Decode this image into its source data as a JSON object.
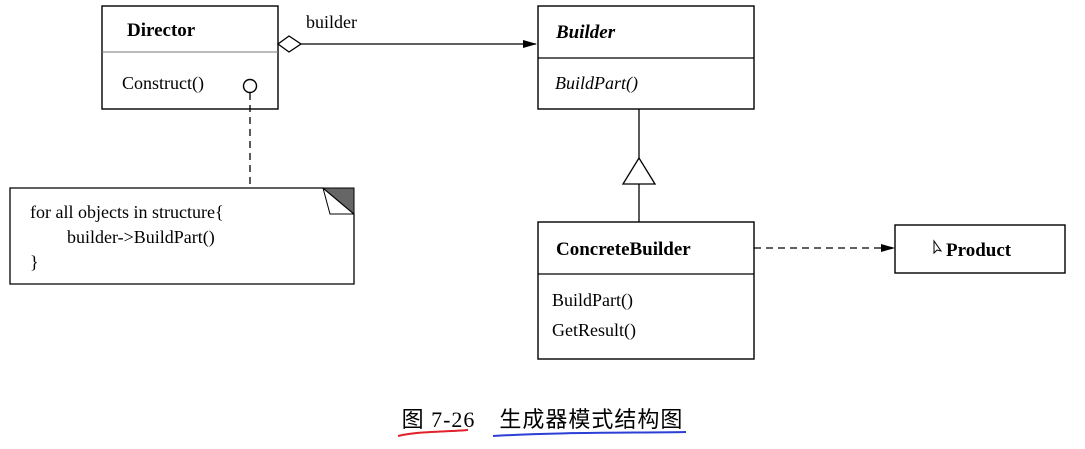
{
  "director": {
    "name": "Director",
    "operations": [
      "Construct()"
    ]
  },
  "builder": {
    "name": "Builder",
    "operations": [
      "BuildPart()"
    ]
  },
  "concrete_builder": {
    "name": "ConcreteBuilder",
    "operations": [
      "BuildPart()",
      "GetResult()"
    ]
  },
  "product": {
    "name": "Product"
  },
  "association_label": "builder",
  "note": {
    "lines": [
      "for all objects in structure{",
      "builder->BuildPart()",
      "}"
    ]
  },
  "caption": {
    "number": "图 7-26",
    "title": "生成器模式结构图"
  }
}
